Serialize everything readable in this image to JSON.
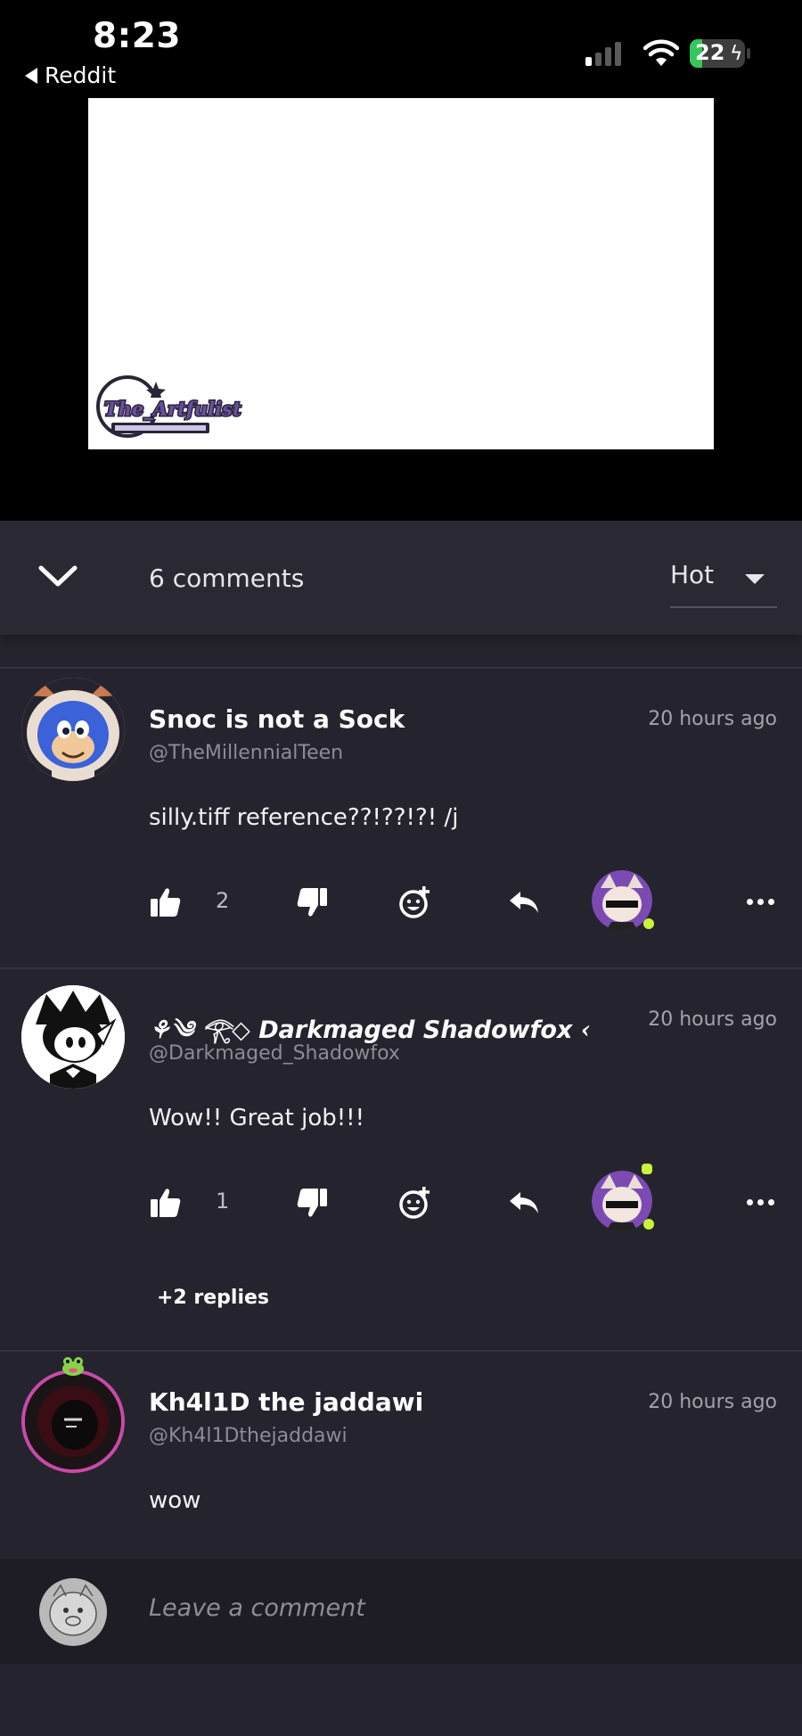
{
  "status_bar": {
    "time": "8:23",
    "back_app": "Reddit",
    "battery": "22",
    "battery_level": 0.22,
    "signal_bars_active": 1
  },
  "media": {
    "watermark_text": "The_Artfulist"
  },
  "comments_header": {
    "count_label": "6 comments",
    "sort_label": "Hot"
  },
  "comments": [
    {
      "author": "Snoc is not a Sock",
      "handle": "@TheMillennialTeen",
      "time": "20 hours ago",
      "text": "silly.tiff reference??!??!?! /j",
      "likes": "2"
    },
    {
      "author": "⚘༄ 𓂀◇ 𝘿𝙖𝙧𝙠𝙢𝙖𝙜𝙚𝙙 𝙎𝙝𝙖𝙙𝙤𝙬𝙛𝙤𝙭 ‹",
      "handle": "@Darkmaged_Shadowfox",
      "time": "20 hours ago",
      "text": "Wow!! Great job!!!",
      "likes": "1",
      "replies_label": "+2 replies"
    },
    {
      "author": "Kh4l1D the jaddawi",
      "handle": "@Kh4l1Dthejaddawi",
      "time": "20 hours ago",
      "text": "wow"
    }
  ],
  "compose": {
    "placeholder": "Leave a comment"
  },
  "colors": {
    "panel": "#25242e",
    "header": "#292833",
    "accent_green": "#c8f43a",
    "battery_green": "#35c759"
  }
}
